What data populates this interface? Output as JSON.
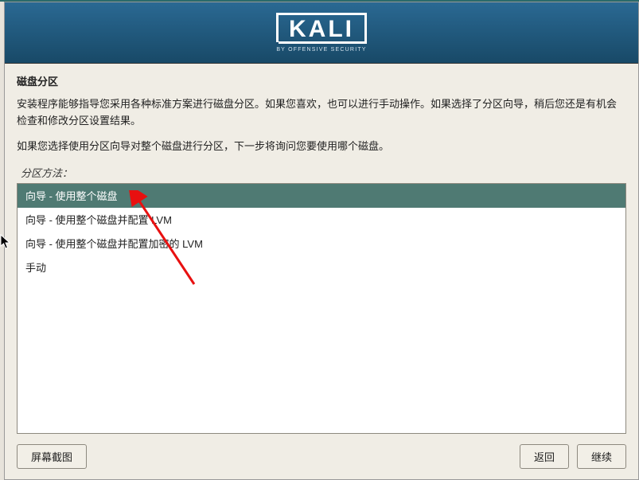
{
  "header": {
    "logo_text": "KALI",
    "logo_subtitle": "BY OFFENSIVE SECURITY"
  },
  "title": "磁盘分区",
  "instructions": {
    "line1": "安装程序能够指导您采用各种标准方案进行磁盘分区。如果您喜欢，也可以进行手动操作。如果选择了分区向导，稍后您还是有机会检查和修改分区设置结果。",
    "line2": "如果您选择使用分区向导对整个磁盘进行分区，下一步将询问您要使用哪个磁盘。"
  },
  "method_label": "分区方法：",
  "options": [
    {
      "label": "向导 - 使用整个磁盘",
      "selected": true
    },
    {
      "label": "向导 - 使用整个磁盘并配置 LVM",
      "selected": false
    },
    {
      "label": "向导 - 使用整个磁盘并配置加密的 LVM",
      "selected": false
    },
    {
      "label": "手动",
      "selected": false
    }
  ],
  "buttons": {
    "screenshot": "屏幕截图",
    "back": "返回",
    "continue": "继续"
  }
}
